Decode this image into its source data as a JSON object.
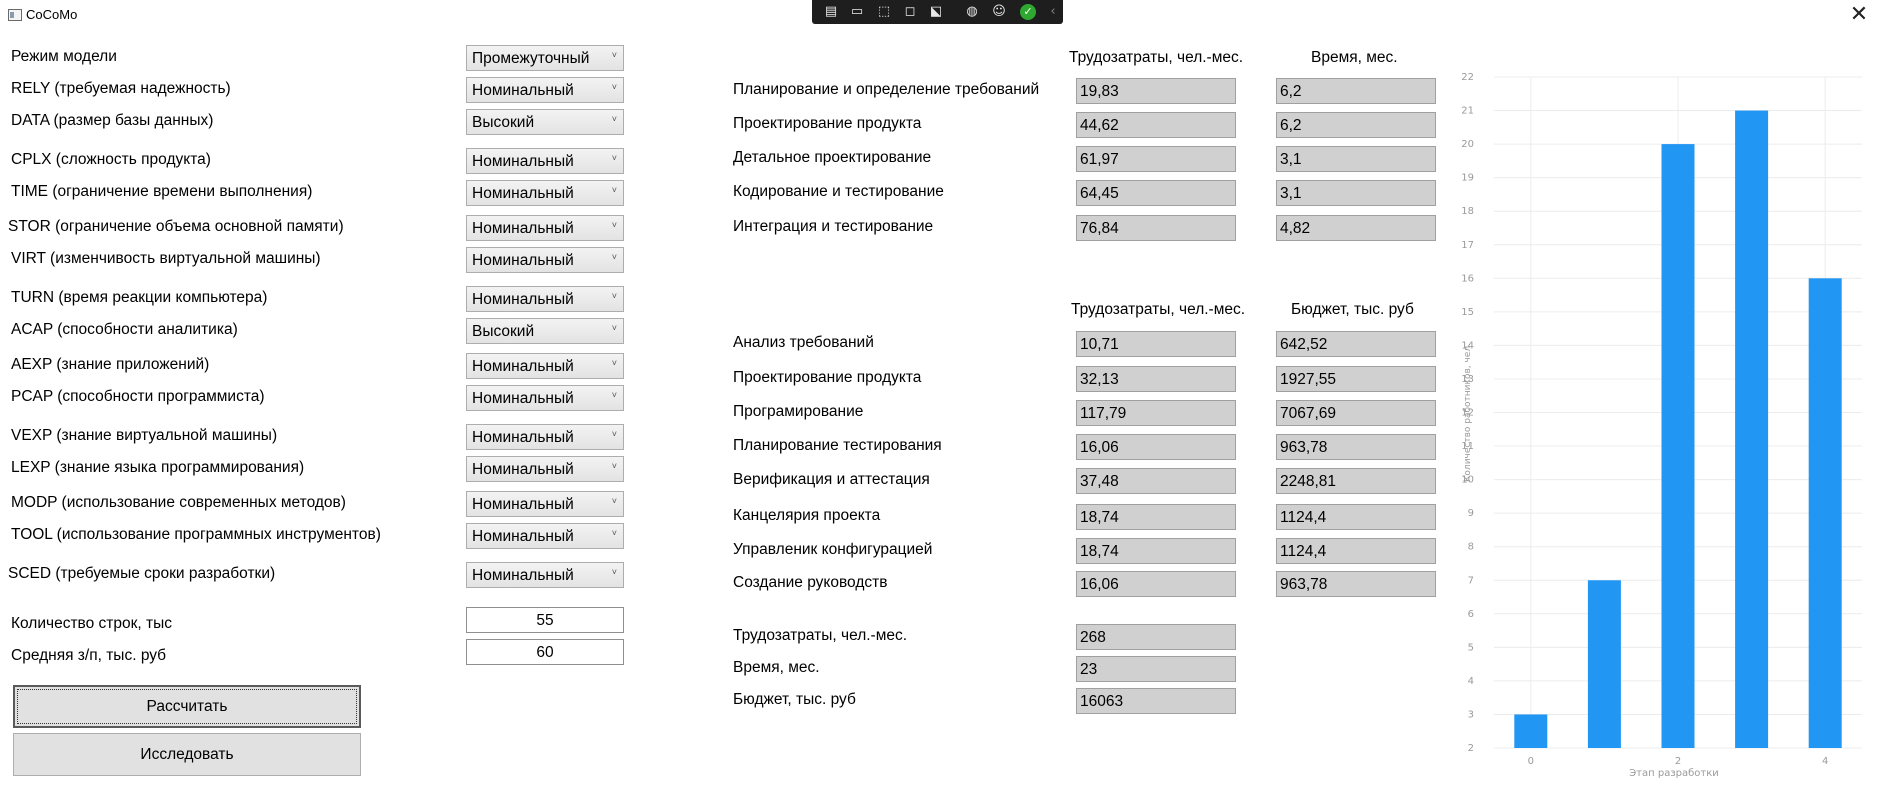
{
  "window": {
    "title": "CoCoMo",
    "close_icon": "✕"
  },
  "debug_toolbar": {
    "icons": [
      "live-tree-icon",
      "video-icon",
      "select-element-icon",
      "layout-adorner-icon",
      "track-focus-icon",
      "binding-failures-icon",
      "accessibility-icon",
      "check-icon",
      "collapse-chevron-icon"
    ]
  },
  "params": [
    {
      "label": "Режим модели",
      "value": "Промежуточный"
    },
    {
      "label": "RELY (требуемая надежность)",
      "value": "Номинальный"
    },
    {
      "label": "DATA (размер базы данных)",
      "value": "Высокий"
    },
    {
      "label": "CPLX (сложность продукта)",
      "value": "Номинальный"
    },
    {
      "label": "TIME (ограничение времени выполнения)",
      "value": "Номинальный"
    },
    {
      "label": "STOR (ограничение объема основной памяти)",
      "value": "Номинальный"
    },
    {
      "label": "VIRT (изменчивость виртуальной машины)",
      "value": "Номинальный"
    },
    {
      "label": "TURN (время реакции компьютера)",
      "value": "Номинальный"
    },
    {
      "label": "ACAP (способности аналитика)",
      "value": "Высокий"
    },
    {
      "label": "AEXP (знание приложений)",
      "value": "Номинальный"
    },
    {
      "label": "PCAP (способности программиста)",
      "value": "Номинальный"
    },
    {
      "label": "VEXP (знание виртуальной машины)",
      "value": "Номинальный"
    },
    {
      "label": "LEXP (знание языка программирования)",
      "value": "Номинальный"
    },
    {
      "label": "MODP (использование современных методов)",
      "value": "Номинальный"
    },
    {
      "label": "TOOL (использование программных инструментов)",
      "value": "Номинальный"
    },
    {
      "label": "SCED (требуемые сроки разработки)",
      "value": "Номинальный"
    }
  ],
  "inputs": {
    "lines": {
      "label": "Количество строк, тыс",
      "value": "55"
    },
    "salary": {
      "label": "Средняя з/п, тыс. руб",
      "value": "60"
    }
  },
  "buttons": {
    "calculate": "Рассчитать",
    "research": "Исследовать"
  },
  "phases": {
    "col1": "Трудозатраты, чел.-мес.",
    "col2": "Время, мес.",
    "rows": [
      {
        "label": "Планирование и определение требований",
        "effort": "19,83",
        "time": "6,2"
      },
      {
        "label": "Проектирование продукта",
        "effort": "44,62",
        "time": "6,2"
      },
      {
        "label": "Детальное проектирование",
        "effort": "61,97",
        "time": "3,1"
      },
      {
        "label": "Кодирование и тестирование",
        "effort": "64,45",
        "time": "3,1"
      },
      {
        "label": "Интеграция и тестирование",
        "effort": "76,84",
        "time": "4,82"
      }
    ]
  },
  "activities": {
    "col1": "Трудозатраты, чел.-мес.",
    "col2": "Бюджет, тыс. руб",
    "rows": [
      {
        "label": "Анализ требований",
        "effort": "10,71",
        "budget": "642,52"
      },
      {
        "label": "Проектирование продукта",
        "effort": "32,13",
        "budget": "1927,55"
      },
      {
        "label": "Програмирование",
        "effort": "117,79",
        "budget": "7067,69"
      },
      {
        "label": "Планирование тестирования",
        "effort": "16,06",
        "budget": "963,78"
      },
      {
        "label": "Верификация и аттестация",
        "effort": "37,48",
        "budget": "2248,81"
      },
      {
        "label": "Канцелярия проекта",
        "effort": "18,74",
        "budget": "1124,4"
      },
      {
        "label": "Управленик конфигурацией",
        "effort": "18,74",
        "budget": "1124,4"
      },
      {
        "label": "Создание руководств",
        "effort": "16,06",
        "budget": "963,78"
      }
    ]
  },
  "totals": [
    {
      "label": "Трудозатраты, чел.-мес.",
      "value": "268"
    },
    {
      "label": "Время, мес.",
      "value": "23"
    },
    {
      "label": "Бюджет, тыс. руб",
      "value": "16063"
    }
  ],
  "chart_data": {
    "type": "bar",
    "x": [
      0,
      1,
      2,
      3,
      4
    ],
    "values": [
      3,
      7,
      20,
      21,
      16
    ],
    "xlabel": "Этап разработки",
    "ylabel": "Количество работников, чел.",
    "ylim": [
      2,
      22
    ],
    "yticks": [
      2,
      3,
      4,
      5,
      6,
      7,
      8,
      9,
      10,
      11,
      12,
      13,
      14,
      15,
      16,
      17,
      18,
      19,
      20,
      21,
      22
    ],
    "xticks": [
      0,
      2,
      4
    ],
    "grid": true,
    "colors": {
      "bar": "#2196f3",
      "grid": "#ececec",
      "tick": "#9a9a9a"
    }
  }
}
